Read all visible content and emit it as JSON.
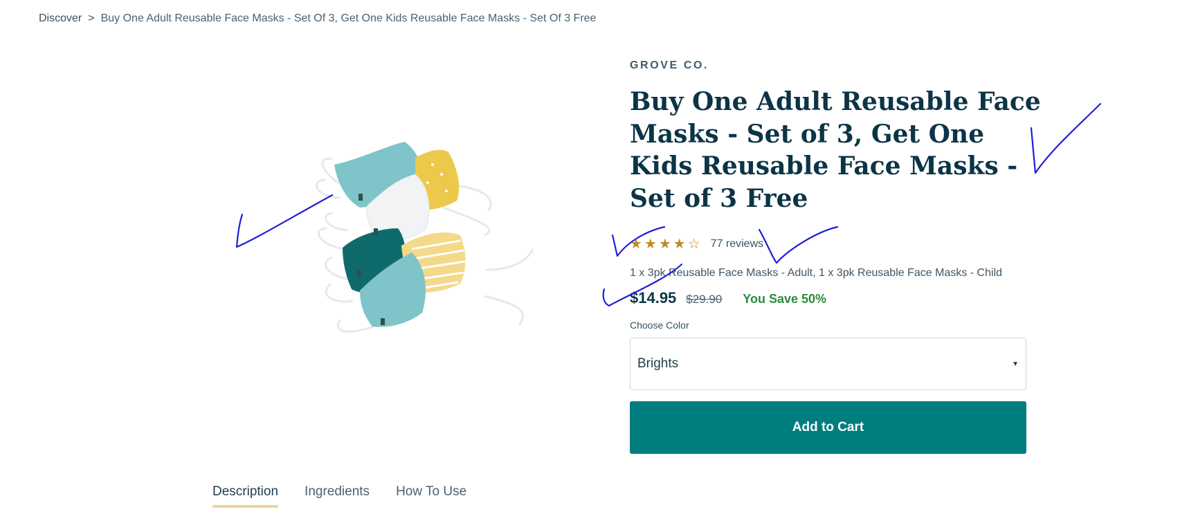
{
  "breadcrumb": {
    "root": "Discover",
    "separator": ">",
    "current": "Buy One Adult Reusable Face Masks - Set Of 3, Get One Kids Reusable Face Masks - Set Of 3 Free"
  },
  "product": {
    "brand": "GROVE CO.",
    "title": "Buy One Adult Reusable Face Masks - Set of 3, Get One Kids Reusable Face Masks - Set of 3 Free",
    "rating_stars": "★★★★☆",
    "rating": 4,
    "rating_max": 5,
    "reviews": "77 reviews",
    "variant": "1 x 3pk Reusable Face Masks - Adult, 1 x 3pk Reusable Face Masks - Child",
    "price": "$14.95",
    "old_price": "$29.90",
    "savings": "You Save 50%",
    "image_icon": "face-masks-product-photo",
    "mask_colors": [
      "#7fc4c8",
      "#ecc94a",
      "#f1f3f4",
      "#0f6b6b",
      "#f3d98a"
    ]
  },
  "color_select": {
    "label": "Choose Color",
    "value": "Brights"
  },
  "cart": {
    "label": "Add to Cart",
    "color": "#007e7f"
  },
  "tabs": [
    {
      "label": "Description",
      "active": true
    },
    {
      "label": "Ingredients",
      "active": false
    },
    {
      "label": "How To Use",
      "active": false
    }
  ],
  "colors": {
    "heading": "#0c3447",
    "star": "#c28a24",
    "savings": "#2c8a3a",
    "tab_underline": "#ecd49b",
    "annotation_ink": "#1f1fd6"
  }
}
